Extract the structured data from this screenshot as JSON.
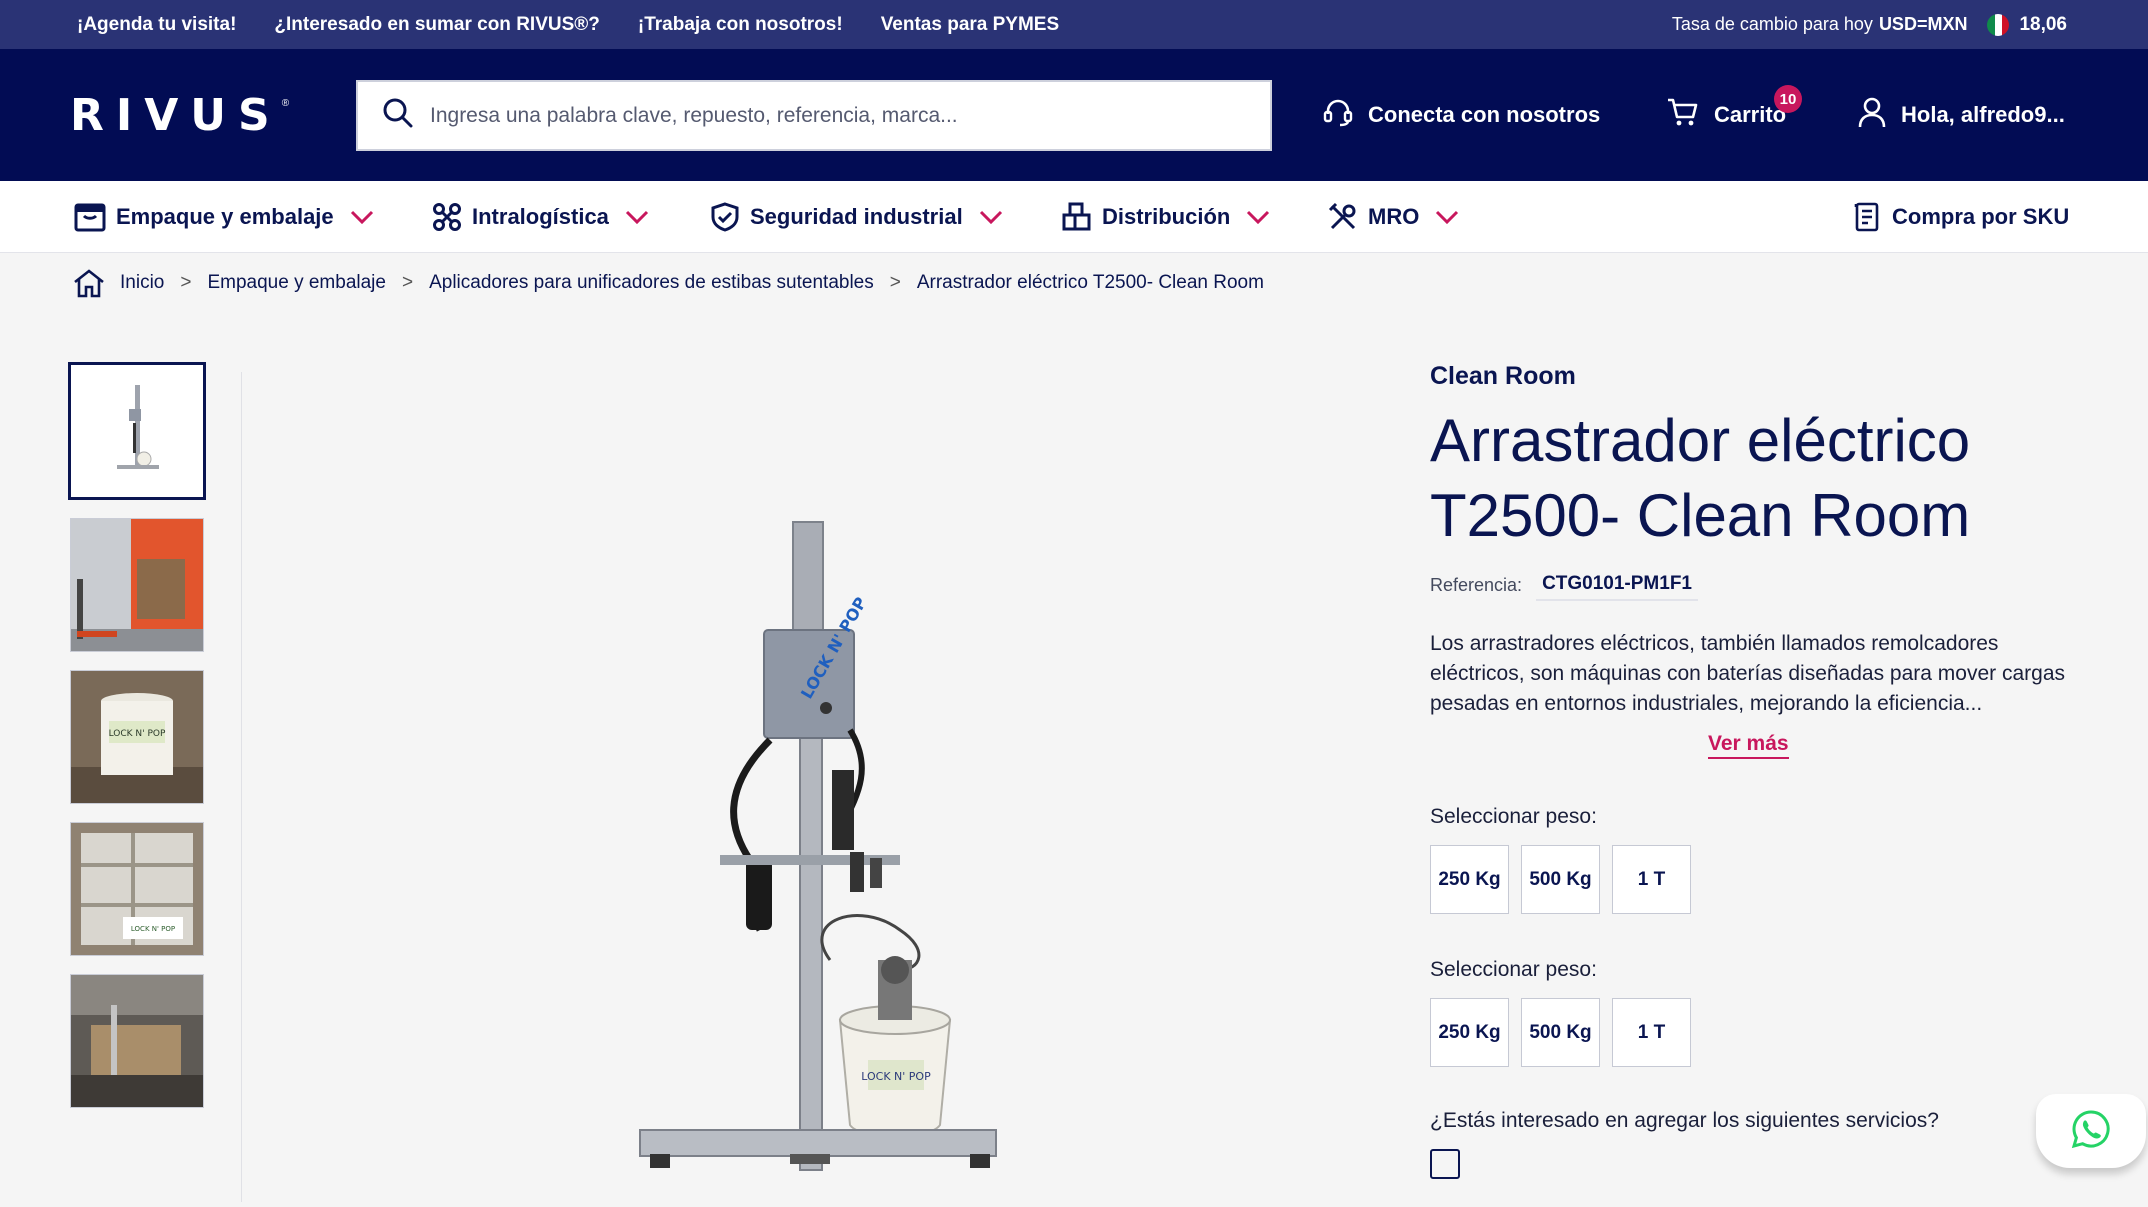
{
  "topbar": {
    "links": [
      "¡Agenda tu visita!",
      "¿Interesado en sumar con RIVUS®?",
      "¡Trabaja con nosotros!",
      "Ventas para PYMES"
    ],
    "rate_label": "Tasa de cambio para hoy",
    "rate_pair": "USD=MXN",
    "rate_value": "18,06"
  },
  "header": {
    "logo": "RIVUS",
    "logo_mark": "®",
    "search_placeholder": "Ingresa una palabra clave, repuesto, referencia, marca...",
    "connect_label": "Conecta con nosotros",
    "cart_label": "Carrito",
    "cart_count": "10",
    "user_label": "Hola, alfredo9..."
  },
  "nav": {
    "categories": [
      "Empaque y embalaje",
      "Intralogística",
      "Seguridad industrial",
      "Distribución",
      "MRO"
    ],
    "sku_label": "Compra por SKU"
  },
  "breadcrumb": [
    "Inicio",
    "Empaque y embalaje",
    "Aplicadores para unificadores de estibas sutentables",
    "Arrastrador eléctrico T2500- Clean Room"
  ],
  "product": {
    "brand": "Clean Room",
    "title": "Arrastrador eléctrico T2500- Clean Room",
    "reference_label": "Referencia:",
    "reference": "CTG0101-PM1F1",
    "description": "Los arrastradores eléctricos, también llamados remolcadores eléctricos, son máquinas con baterías diseñadas para mover cargas pesadas en entornos industriales, mejorando la eficiencia...",
    "more_label": "Ver más",
    "weight_groups": [
      {
        "label": "Seleccionar peso:",
        "options": [
          "250 Kg",
          "500 Kg",
          "1 T"
        ]
      },
      {
        "label": "Seleccionar peso:",
        "options": [
          "250 Kg",
          "500 Kg",
          "1 T"
        ]
      }
    ],
    "services_label": "¿Estás interesado en agregar  los siguientes servicios?"
  },
  "colors": {
    "navy": "#020c54",
    "topbar": "#2a3375",
    "accent": "#c8175d",
    "text": "#0a1551"
  },
  "icons": [
    "search-icon",
    "headset-icon",
    "cart-icon",
    "user-icon",
    "box-icon",
    "intralogistics-icon",
    "shield-icon",
    "distribution-icon",
    "tools-icon",
    "sku-list-icon",
    "home-icon",
    "whatsapp-icon",
    "chevron-down-icon"
  ]
}
